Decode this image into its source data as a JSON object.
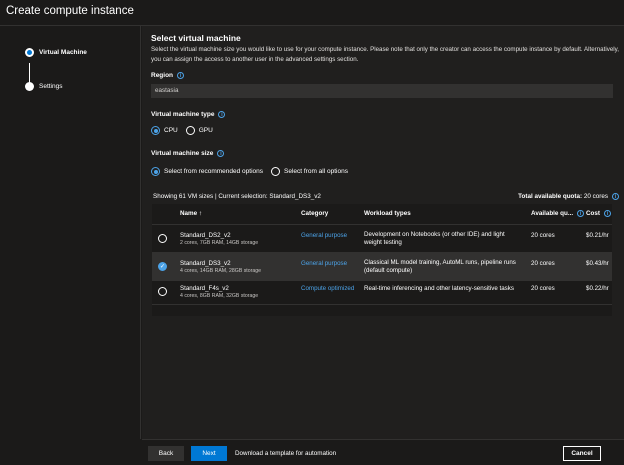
{
  "window": {
    "title": "Create compute instance"
  },
  "steps": [
    {
      "label": "Virtual Machine",
      "state": "active"
    },
    {
      "label": "Settings",
      "state": "inactive"
    }
  ],
  "main": {
    "title": "Select virtual machine",
    "description": "Select the virtual machine size you would like to use for your compute instance. Please note that only the creator can access the compute instance by default. Alternatively, you can assign the access to another user in the advanced settings section.",
    "region": {
      "label": "Region",
      "value": "eastasia"
    },
    "vm_type": {
      "label": "Virtual machine type",
      "options": [
        "CPU",
        "GPU"
      ],
      "selected": "CPU"
    },
    "vm_size": {
      "label": "Virtual machine size",
      "options": [
        "Select from recommended options",
        "Select from all options"
      ],
      "selected": "Select from recommended options"
    }
  },
  "table": {
    "summary": "Showing 61 VM sizes | Current selection: Standard_DS3_v2",
    "quota_label": "Total available quota:",
    "quota_value": "20 cores",
    "columns": [
      "Name ↑",
      "Category",
      "Workload types",
      "Available qu...",
      "Cost"
    ],
    "rows": [
      {
        "name": "Standard_DS2_v2",
        "specs": "2 cores, 7GB RAM, 14GB storage",
        "category": "General purpose",
        "workload": "Development on Notebooks (or other IDE) and light weight testing",
        "available": "20 cores",
        "cost": "$0.21/hr",
        "selected": false
      },
      {
        "name": "Standard_DS3_v2",
        "specs": "4 cores, 14GB RAM, 28GB storage",
        "category": "General purpose",
        "workload": "Classical ML model training, AutoML runs, pipeline runs (default compute)",
        "available": "20 cores",
        "cost": "$0.43/hr",
        "selected": true
      },
      {
        "name": "Standard_F4s_v2",
        "specs": "4 cores, 8GB RAM, 32GB storage",
        "category": "Compute optimized",
        "workload": "Real-time inferencing and other latency-sensitive tasks",
        "available": "20 cores",
        "cost": "$0.22/hr",
        "selected": false
      }
    ]
  },
  "footer": {
    "back_label": "Back",
    "next_label": "Next",
    "template_label": "Download a template for automation",
    "cancel_label": "Cancel"
  },
  "colors": {
    "accent": "#0078d4",
    "link": "#4ca3e8",
    "background": "#1b1a19",
    "panel": "#201f1e"
  },
  "icons": {
    "info": "info-circle-icon",
    "step_active": "step-active-icon",
    "sort": "sort-ascending-icon",
    "check": "checkmark-icon"
  }
}
